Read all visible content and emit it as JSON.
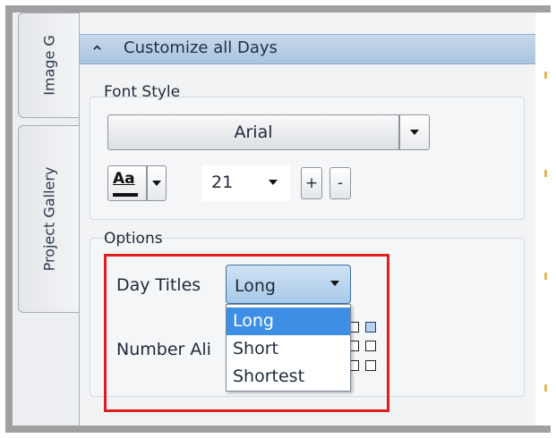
{
  "side_tabs": [
    {
      "label": "Image G"
    },
    {
      "label": "Project Gallery"
    }
  ],
  "section": {
    "title": "Customize all Days"
  },
  "font_style": {
    "label": "Font Style",
    "font_name": "Arial",
    "text_format_icon_label": "Aa",
    "size_value": "21",
    "increase_label": "+",
    "decrease_label": "-"
  },
  "options": {
    "label": "Options",
    "day_titles_label": "Day Titles",
    "day_titles_value": "Long",
    "day_titles_options": [
      "Long",
      "Short",
      "Shortest"
    ],
    "selected_option": "Long",
    "number_alignment_label": "Number Ali"
  },
  "colors": {
    "header_blue": "#a9c4df",
    "selection_blue": "#3e8ee6",
    "highlight_red": "#e01e1e",
    "right_marker": "#e3b65a"
  }
}
